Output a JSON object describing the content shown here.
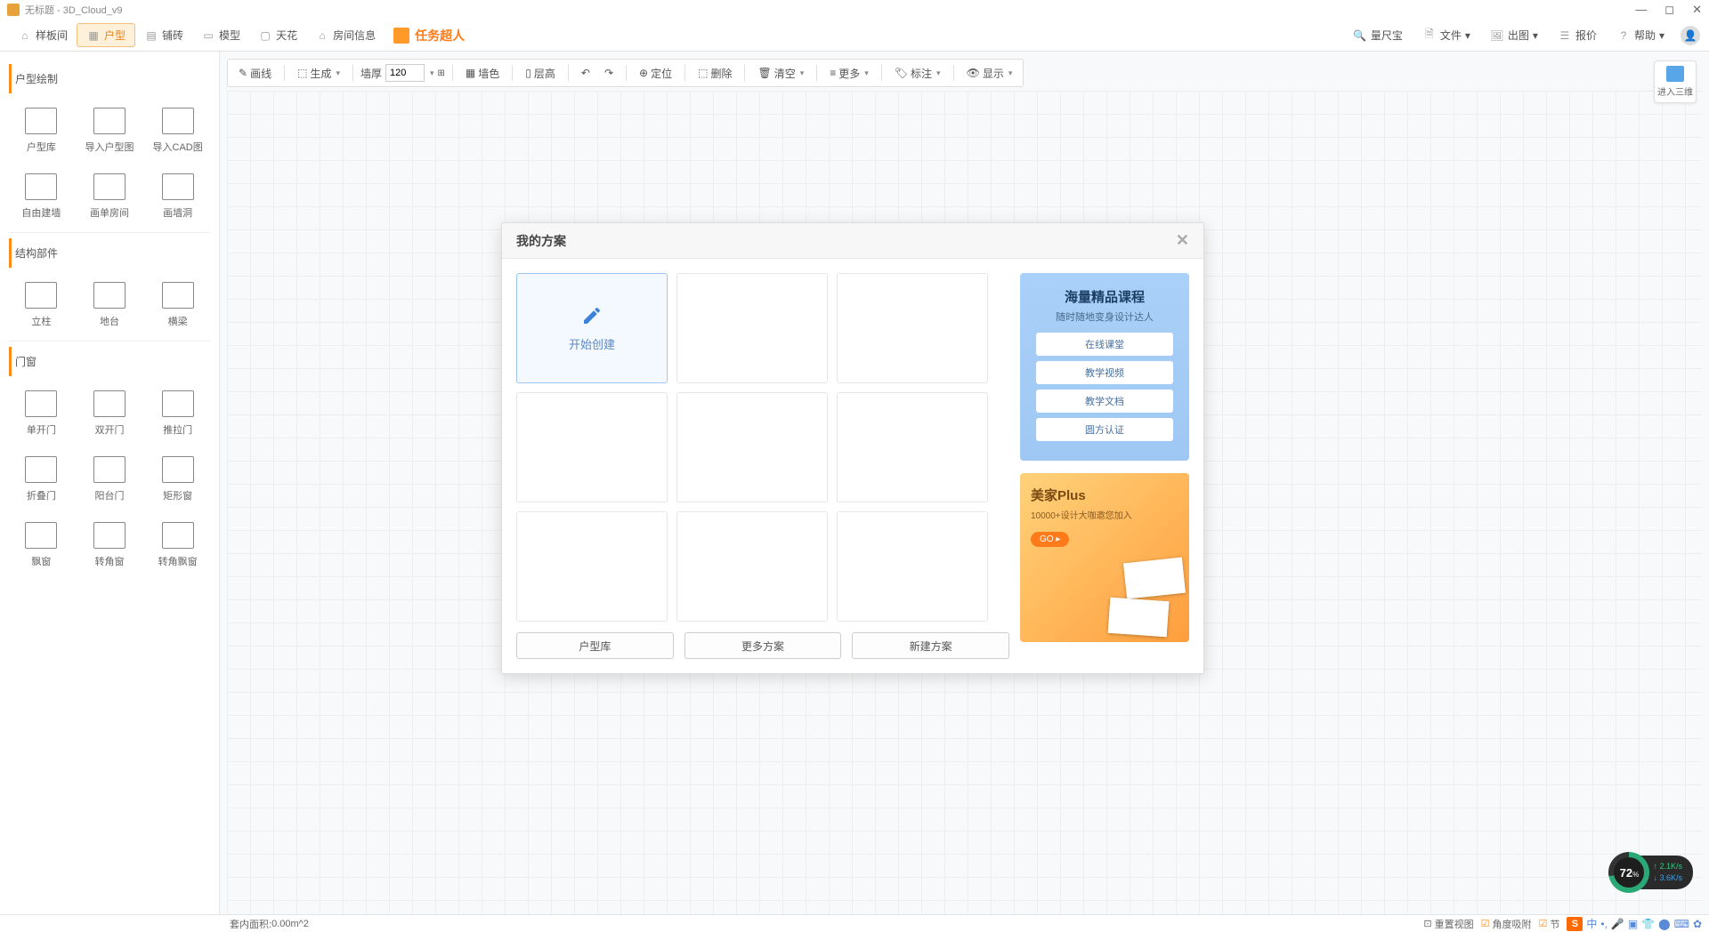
{
  "title": "无标题 - 3D_Cloud_v9",
  "mainToolbar": {
    "left": [
      {
        "id": "template",
        "label": "样板间"
      },
      {
        "id": "plan",
        "label": "户型",
        "active": true
      },
      {
        "id": "tile",
        "label": "铺砖"
      },
      {
        "id": "model",
        "label": "模型"
      },
      {
        "id": "ceiling",
        "label": "天花"
      },
      {
        "id": "roominfo",
        "label": "房间信息"
      }
    ],
    "brand": "任务超人",
    "right": [
      {
        "id": "ruler",
        "label": "量尺宝"
      },
      {
        "id": "file",
        "label": "文件"
      },
      {
        "id": "export",
        "label": "出图"
      },
      {
        "id": "quote",
        "label": "报价"
      },
      {
        "id": "help",
        "label": "帮助"
      }
    ]
  },
  "subToolbar": {
    "draw": "画线",
    "generate": "生成",
    "wallThickLabel": "墙厚",
    "wallThick": "120",
    "wallColor": "墙色",
    "floorHeight": "层高",
    "locate": "定位",
    "delete": "删除",
    "clear": "清空",
    "more": "更多",
    "mark": "标注",
    "display": "显示"
  },
  "enter3d": "进入三维",
  "sidebar": {
    "sections": [
      {
        "title": "户型绘制",
        "items": [
          {
            "label": "户型库"
          },
          {
            "label": "导入户型图"
          },
          {
            "label": "导入CAD图"
          },
          {
            "label": "自由建墙"
          },
          {
            "label": "画单房间"
          },
          {
            "label": "画墙洞"
          }
        ]
      },
      {
        "title": "结构部件",
        "items": [
          {
            "label": "立柱"
          },
          {
            "label": "地台"
          },
          {
            "label": "横梁"
          }
        ]
      },
      {
        "title": "门窗",
        "items": [
          {
            "label": "单开门"
          },
          {
            "label": "双开门"
          },
          {
            "label": "推拉门"
          },
          {
            "label": "折叠门"
          },
          {
            "label": "阳台门"
          },
          {
            "label": "矩形窗"
          },
          {
            "label": "飘窗"
          },
          {
            "label": "转角窗"
          },
          {
            "label": "转角飘窗"
          }
        ]
      }
    ]
  },
  "modal": {
    "title": "我的方案",
    "create": "开始创建",
    "buttons": {
      "lib": "户型库",
      "more": "更多方案",
      "new": "新建方案"
    },
    "promo1": {
      "title": "海量精品课程",
      "subtitle": "随时随地变身设计达人",
      "btns": [
        "在线课堂",
        "教学视频",
        "教学文档",
        "圆方认证"
      ]
    },
    "promo2": {
      "title": "美家Plus",
      "subtitle": "10000+设计大咖邀您加入",
      "go": "GO ▸"
    }
  },
  "status": {
    "area_label": "套内面积:",
    "area_value": "0.00m^2",
    "resetView": "重置视图",
    "angleSnap": "角度吸附",
    "node": "节"
  },
  "perf": {
    "pct": "72",
    "unit": "%",
    "up": "2.1K/s",
    "down": "3.6K/s"
  }
}
